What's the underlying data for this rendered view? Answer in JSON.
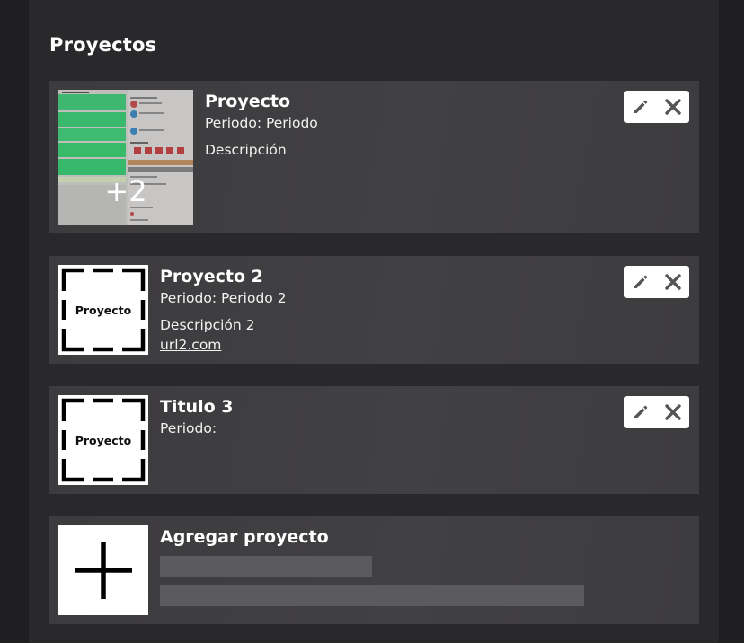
{
  "section": {
    "title": "Proyectos"
  },
  "projects": [
    {
      "title": "Proyecto",
      "periodo": "Periodo: Periodo",
      "descripcion": "Descripción",
      "extra_images": "+2"
    },
    {
      "title": "Proyecto 2",
      "periodo": "Periodo: Periodo 2",
      "descripcion": "Descripción 2",
      "url": "url2.com",
      "thumb_label": "Proyecto"
    },
    {
      "title": "Titulo 3",
      "periodo": "Periodo:",
      "thumb_label": "Proyecto"
    }
  ],
  "add": {
    "title": "Agregar proyecto"
  },
  "icons": {
    "edit": "pencil-icon",
    "delete": "close-icon",
    "add": "plus-icon"
  },
  "colors": {
    "background": "#1f1f21",
    "panel": "#29292b",
    "card": "#3e3d3f",
    "skeleton": "#5b5a5c"
  }
}
